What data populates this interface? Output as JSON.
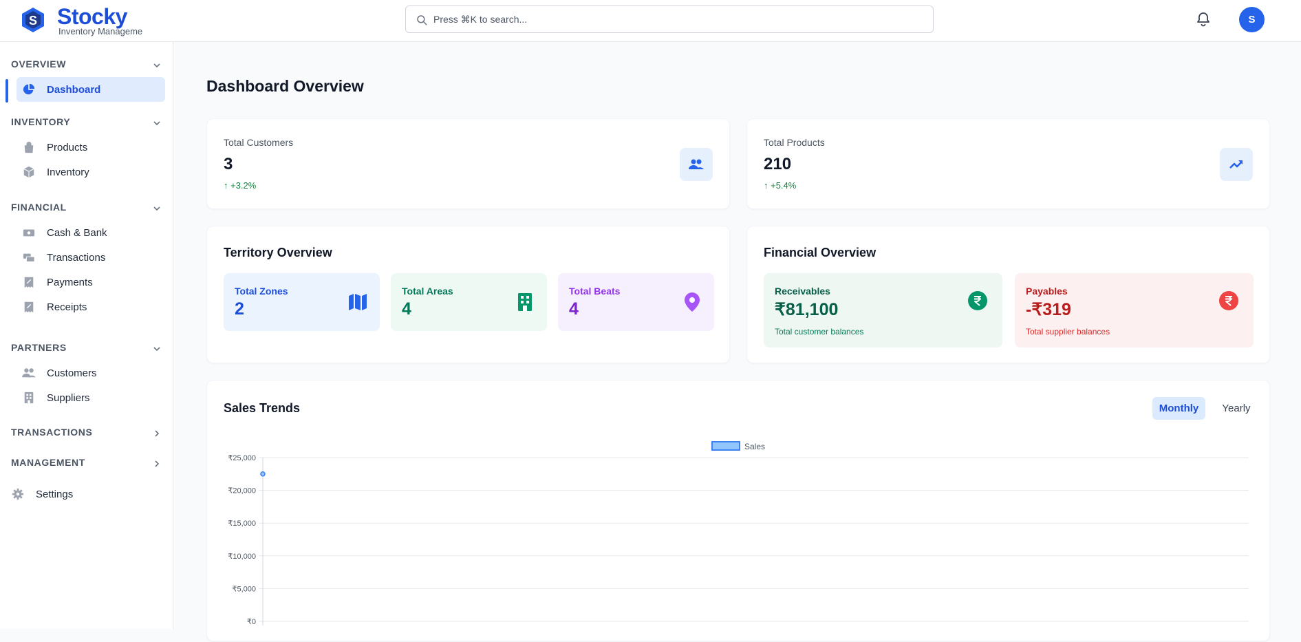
{
  "app": {
    "brand": "Stocky",
    "brand_sub": "Inventory Manageme",
    "brand_color": "#1d4ed8",
    "logo_letter": "S"
  },
  "header": {
    "search_placeholder": "Press ⌘K to search...",
    "avatar_initial": "S",
    "bell_icon": "bell-icon"
  },
  "sidebar": {
    "sections": [
      {
        "label": "OVERVIEW",
        "items": [
          {
            "label": "Dashboard",
            "icon": "pie-chart-icon",
            "active": true
          }
        ]
      },
      {
        "label": "INVENTORY",
        "items": [
          {
            "label": "Products",
            "icon": "bag-icon"
          },
          {
            "label": "Inventory",
            "icon": "box-icon"
          }
        ]
      },
      {
        "label": "FINANCIAL",
        "items": [
          {
            "label": "Cash & Bank",
            "icon": "cash-icon"
          },
          {
            "label": "Transactions",
            "icon": "transfer-icon"
          },
          {
            "label": "Payments",
            "icon": "receipt-tax-icon"
          },
          {
            "label": "Receipts",
            "icon": "receipt-tax-icon"
          }
        ]
      },
      {
        "label": "PARTNERS",
        "items": [
          {
            "label": "Customers",
            "icon": "users-icon"
          },
          {
            "label": "Suppliers",
            "icon": "office-building-icon"
          }
        ]
      },
      {
        "label": "TRANSACTIONS",
        "items": []
      },
      {
        "label": "MANAGEMENT",
        "items": []
      }
    ],
    "settings_label": "Settings"
  },
  "main": {
    "title": "Dashboard Overview",
    "stats": [
      {
        "label": "Total Customers",
        "value": "3",
        "change": "↑ +3.2%",
        "icon": "users-icon"
      },
      {
        "label": "Total Products",
        "value": "210",
        "change": "↑ +5.4%",
        "icon": "trending-up-icon"
      }
    ],
    "territory": {
      "title": "Territory Overview",
      "tiles": [
        {
          "label": "Total Zones",
          "value": "2",
          "icon": "map-icon",
          "color": "#1d4ed8",
          "bg": "#eaf3fe"
        },
        {
          "label": "Total Areas",
          "value": "4",
          "icon": "building-icon",
          "color": "#047857",
          "bg": "#eef9f3"
        },
        {
          "label": "Total Beats",
          "value": "4",
          "icon": "location-pin-icon",
          "color": "#7e22ce",
          "bg": "#f6f0fe"
        }
      ]
    },
    "financial": {
      "title": "Financial Overview",
      "receivables": {
        "label": "Receivables",
        "value": "₹81,100",
        "sub": "Total customer balances",
        "icon": "rupee-icon"
      },
      "payables": {
        "label": "Payables",
        "value": "-₹319",
        "sub": "Total supplier balances",
        "icon": "rupee-icon"
      }
    },
    "sales": {
      "title": "Sales Trends",
      "toggle_monthly": "Monthly",
      "toggle_yearly": "Yearly",
      "active_toggle": "Monthly"
    }
  },
  "chart_data": {
    "type": "line",
    "legend": [
      "Sales"
    ],
    "legend_placement": "top-center",
    "series": [
      {
        "name": "Sales",
        "values": [
          22500
        ],
        "color": "#3b82f6"
      }
    ],
    "y_ticks": [
      "₹25,000",
      "₹20,000",
      "₹15,000",
      "₹10,000",
      "₹5,000",
      "₹0"
    ],
    "ylim": [
      0,
      25000
    ],
    "grid": true
  }
}
